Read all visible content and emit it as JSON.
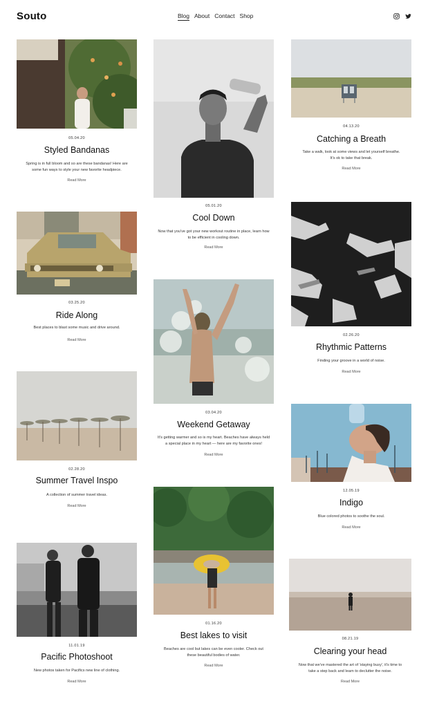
{
  "site": {
    "logo": "Souto"
  },
  "nav": [
    {
      "label": "Blog",
      "active": true
    },
    {
      "label": "About"
    },
    {
      "label": "Contact"
    },
    {
      "label": "Shop"
    }
  ],
  "social": [
    {
      "icon": "instagram-icon"
    },
    {
      "icon": "twitter-icon"
    }
  ],
  "posts": [
    {
      "date": "05.04.20",
      "title": "Styled Bandanas",
      "excerpt": "Spring is in full bloom and so are these bandanas! Here are some fun ways to style your new favorite headpiece.",
      "more": "Read More"
    },
    {
      "date": "05.01.20",
      "title": "Cool Down",
      "excerpt": "Now that you've got your new workout routine in place, learn how to be efficient in cooling down.",
      "more": "Read More"
    },
    {
      "date": "04.13.20",
      "title": "Catching a Breath",
      "excerpt": "Take a walk, look at some views and let yourself breathe. It's ok to take that break.",
      "more": "Read More"
    },
    {
      "date": "03.25.20",
      "title": "Ride Along",
      "excerpt": "Best places to blast some music and drive around.",
      "more": "Read More"
    },
    {
      "date": "03.04.20",
      "title": "Weekend Getaway",
      "excerpt": "It's getting warmer and so is my heart. Beaches have always held a special place in my heart — here are my favorite ones!",
      "more": "Read More"
    },
    {
      "date": "02.26.20",
      "title": "Rhythmic Patterns",
      "excerpt": "Finding your groove in a world of noise.",
      "more": "Read More"
    },
    {
      "date": "02.28.20",
      "title": "Summer Travel Inspo",
      "excerpt": "A collection of summer travel ideas.",
      "more": "Read More"
    },
    {
      "date": "12.05.19",
      "title": "Indigo",
      "excerpt": "Blue colored photos to soothe the soul.",
      "more": "Read More"
    },
    {
      "date": "01.16.20",
      "title": "Best lakes to visit",
      "excerpt": "Beaches are cool but lakes can be even cooler. Check out these beautiful bodies of water.",
      "more": "Read More"
    },
    {
      "date": "11.01.19",
      "title": "Pacific Photoshoot",
      "excerpt": "New photos taken for Pacifics new line of clothing.",
      "more": "Read More"
    },
    {
      "date": "08.21.19",
      "title": "Clearing your head",
      "excerpt": "Now that we've mastered the art of 'staying busy', it's time to take a step back and learn to declutter the noise.",
      "more": "Read More"
    }
  ]
}
